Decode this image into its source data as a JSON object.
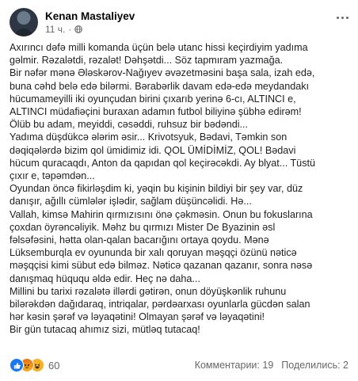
{
  "post": {
    "author": "Kenan Mastaliyev",
    "time": "11 ч.",
    "privacy_icon": "globe-icon",
    "menu_icon": "more-horizontal-icon",
    "lines": [
      "Axırıncı dəfə milli komanda üçün belə utanc hissi keçirdiyim yadıma",
      "gəlmir. Rəzalətdi, rəzalət! Dəhşətdi... Söz tapmıram yazmağa.",
      "Bir nəfər mənə Ələskərov-Nağıyev əvəzetməsini başa sala, izah edə,",
      "buna cəhd belə edə bilərmi. Bərabərlik davam edə-edə meydandakı",
      "hücumameyilli iki oyunçudan birini çıxarıb yerinə 6-cı, ALTINCI e,",
      "ALTINCI müdafiəçini buraxan adamın futbol biliyinə şübhə edirəm!",
      "Ölüb bu adam, meyiddi, cəsəddi, ruhsuz bir bədəndi...",
      "Yadıma düşdükcə ələrim əsir... Krivotsyuk, Bədavi, Təmkin son",
      "dəqiqələrdə bizim qol ümidimiz idi. QOL ÜMİDİMİZ, QOL! Bədavi",
      "hücum quracaqdı, Anton da qapıdan qol keçirəcəkdi. Ay blyat... Tüstü",
      "çıxır e, təpəmdən...",
      "Oyundan öncə fikirləşdim ki, yəqin bu kişinin bildiyi bir şey var, düz",
      "danışır, ağıllı cümlələr işlədir, sağlam düşüncəlidi. Hə...",
      "Vallah, kimsə Mahirin qırmızısını önə çəkməsin. Onun bu fokuslarına",
      "çoxdan öyrəncəliyik. Məhz bu qırmızı Mister De Byazinin əsl",
      "fəlsəfəsini, hətta olan-qalan bacarığını ortaya qoydu. Mənə",
      "Lüksemburqla ev oyununda bir xalı qoruyan məşqçi özünü nəticə",
      "məşqçisi kimi sübut edə bilməz. Nəticə qazanan qazanır, sonra nəsə",
      "danışmaq hüququ əldə edir. Heç nə daha...",
      "Millini bu tarixi rəzalətə illərdi gətirən, onun döyüşkənlik ruhunu",
      "bilərəkdən dağıdaraq, intriqalar, pərdəarxası oyunlarla gücdən salan",
      "hər kəsin şərəf və ləyaqətini! Olmayan şərəf və ləyaqətini!",
      "Bir gün tutacaq ahımız sizi, mütləq tutacaq!"
    ],
    "reactions": {
      "icons": [
        "like-icon",
        "angry-icon",
        "haha-icon"
      ],
      "count": "60"
    },
    "comments": "Комментарии: 19",
    "shares": "Поделились: 2"
  }
}
